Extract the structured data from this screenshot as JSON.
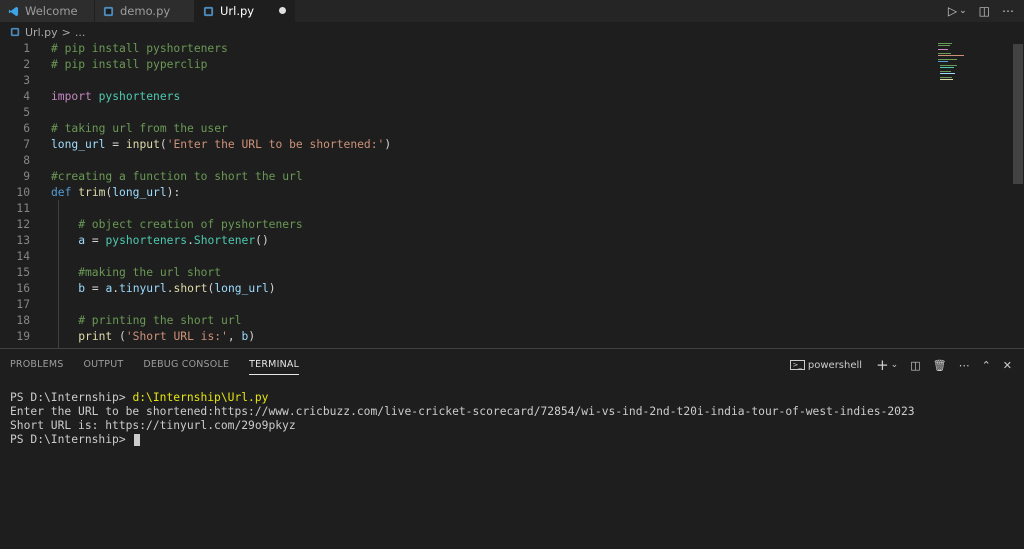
{
  "tabs": [
    {
      "label": "Welcome",
      "icon": "vscode-icon"
    },
    {
      "label": "demo.py",
      "icon": "python-icon"
    },
    {
      "label": "Url.py",
      "icon": "python-icon",
      "active": true,
      "modified": true
    }
  ],
  "breadcrumb": {
    "file": "Url.py",
    "sep": ">",
    "more": "..."
  },
  "editor": {
    "lines": [
      {
        "n": "1",
        "t": "# pip install pyshorteners"
      },
      {
        "n": "2",
        "t": "# pip install pyperclip"
      },
      {
        "n": "3",
        "t": ""
      },
      {
        "n": "4",
        "t": "import pyshorteners"
      },
      {
        "n": "5",
        "t": ""
      },
      {
        "n": "6",
        "t": "# taking url from the user"
      },
      {
        "n": "7",
        "t": "long_url = input('Enter the URL to be shortened:')"
      },
      {
        "n": "8",
        "t": ""
      },
      {
        "n": "9",
        "t": "#creating a function to short the url"
      },
      {
        "n": "10",
        "t": "def trim(long_url):"
      },
      {
        "n": "11",
        "t": ""
      },
      {
        "n": "12",
        "t": "    # object creation of pyshorteners"
      },
      {
        "n": "13",
        "t": "    a = pyshorteners.Shortener()"
      },
      {
        "n": "14",
        "t": ""
      },
      {
        "n": "15",
        "t": "    #making the url short"
      },
      {
        "n": "16",
        "t": "    b = a.tinyurl.short(long_url)"
      },
      {
        "n": "17",
        "t": ""
      },
      {
        "n": "18",
        "t": "    # printing the short url"
      },
      {
        "n": "19",
        "t": "    print ('Short URL is:', b)"
      }
    ]
  },
  "panel": {
    "tabs": [
      "PROBLEMS",
      "OUTPUT",
      "DEBUG CONSOLE",
      "TERMINAL"
    ],
    "active_tab": "TERMINAL",
    "shell_label": "powershell"
  },
  "terminal": {
    "line1_prompt": "PS D:\\Internship> ",
    "line1_cmd": "d:\\Internship\\Url.py",
    "line2": "Enter the URL to be shortened:https://www.cricbuzz.com/live-cricket-scorecard/72854/wi-vs-ind-2nd-t20i-india-tour-of-west-indies-2023",
    "line3": "Short URL is: https://tinyurl.com/29o9pkyz",
    "line4_prompt": "PS D:\\Internship> "
  },
  "colors": {
    "background": "#1e1e1e",
    "comment": "#6a9955",
    "keyword": "#c586c0",
    "string": "#ce9178"
  }
}
